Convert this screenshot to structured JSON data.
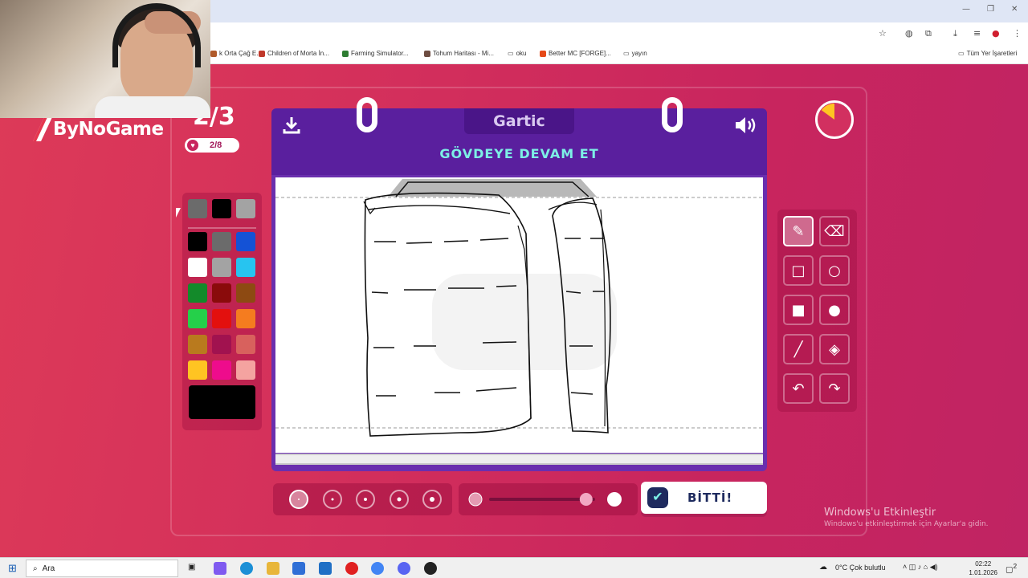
{
  "browser": {
    "window_controls": {
      "minimize": "—",
      "restore": "❐",
      "close": "✕"
    },
    "bookmarks": [
      {
        "label": "k Orta Çağ E...",
        "color": "#b05a2a"
      },
      {
        "label": "Children of Morta İn...",
        "color": "#c0392b"
      },
      {
        "label": "Farming Simulator...",
        "color": "#2e7d32"
      },
      {
        "label": "Tohum Haritası - Mi...",
        "color": "#6d4c41"
      },
      {
        "label": "oku",
        "color": "#555555"
      },
      {
        "label": "Better MC [FORGE]...",
        "color": "#e64a19"
      },
      {
        "label": "yayın",
        "color": "#555555"
      }
    ],
    "all_bookmarks": "Tüm Yer İşaretleri"
  },
  "stream": {
    "brand": "ByNoGame"
  },
  "game": {
    "round": "2/3",
    "players": "2/8",
    "title": "Gartic",
    "instruction": "GÖVDEYE DEVAM ET",
    "done_label": "BİTTİ!",
    "timer_fraction": 0.15,
    "colors": {
      "accent": "#5a1f9e",
      "background": "#d22e5c",
      "instruction": "#7df0e6"
    },
    "palette": [
      [
        "#6b6b6b",
        "#000000",
        "#a3a3a3"
      ],
      [
        "#000000",
        "#6b6b6b",
        "#1452d6"
      ],
      [
        "#ffffff",
        "#a3a3a3",
        "#27c4f0"
      ],
      [
        "#138a2a",
        "#8a0b0b",
        "#8d4a12"
      ],
      [
        "#25d04a",
        "#e3100e",
        "#f57c1f"
      ],
      [
        "#b97a1e",
        "#a1124f",
        "#d8615d"
      ],
      [
        "#ffc422",
        "#ee0c8c",
        "#f4a3a0"
      ]
    ],
    "current_color": "#000000",
    "tools": [
      {
        "name": "pencil-tool",
        "icon": "✎",
        "active": true
      },
      {
        "name": "eraser-tool",
        "icon": "⌫",
        "active": false
      },
      {
        "name": "rectangle-outline-tool",
        "icon": "□",
        "active": false
      },
      {
        "name": "circle-outline-tool",
        "icon": "○",
        "active": false
      },
      {
        "name": "rectangle-fill-tool",
        "icon": "■",
        "active": false
      },
      {
        "name": "circle-fill-tool",
        "icon": "●",
        "active": false
      },
      {
        "name": "line-tool",
        "icon": "╱",
        "active": false
      },
      {
        "name": "fill-bucket-tool",
        "icon": "◈",
        "active": false
      },
      {
        "name": "undo-tool",
        "icon": "↶",
        "active": false
      },
      {
        "name": "redo-tool",
        "icon": "↷",
        "active": false
      }
    ],
    "brush_sizes": [
      1,
      2,
      3,
      4,
      5
    ],
    "selected_brush_size": 1,
    "opacity_level": 0.85
  },
  "os": {
    "activate_title": "Windows'u Etkinleştir",
    "activate_sub": "Windows'u etkinleştirmek için Ayarlar'a gidin.",
    "search_placeholder": "Ara",
    "weather": "0°C  Çok bulutlu",
    "time": "02:22",
    "date": "1.01.2026",
    "notifications": "2"
  }
}
